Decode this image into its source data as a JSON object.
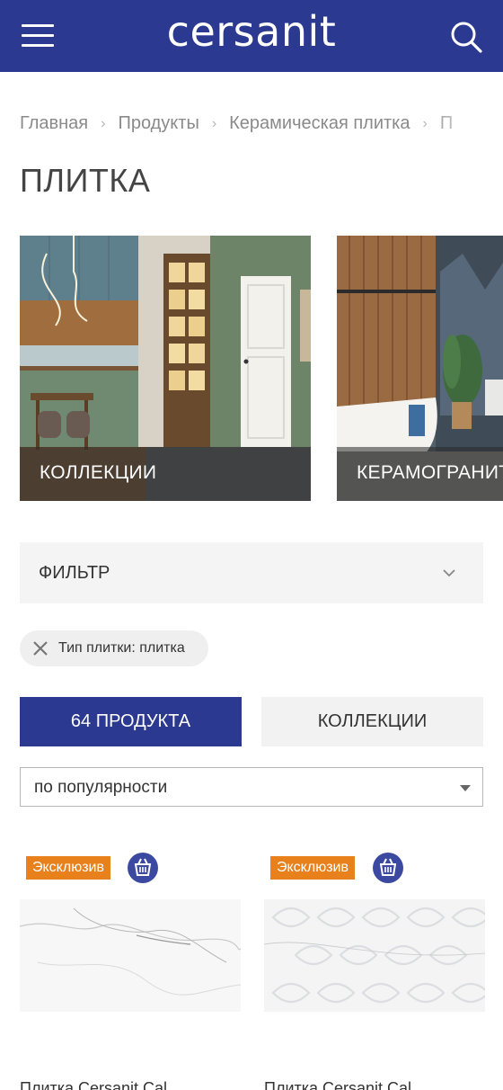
{
  "header": {
    "brand": "cersanit",
    "menu_icon": "hamburger-menu-icon",
    "search_icon": "search-icon",
    "bg_color": "#2b3990"
  },
  "breadcrumbs": [
    "Главная",
    "Продукты",
    "Керамическая плитка",
    "П"
  ],
  "page_title": "ПЛИТКА",
  "category_cards": [
    {
      "label": "КОЛЛЕКЦИИ"
    },
    {
      "label": "КЕРАМОГРАНИТ"
    }
  ],
  "filter": {
    "label": "ФИЛЬТР",
    "icon": "chevron-down-icon"
  },
  "active_filter_chip": {
    "label": "Тип плитки: плитка",
    "icon": "close-icon"
  },
  "tabs": {
    "products_label": "64 ПРОДУКТА",
    "collections_label": "КОЛЛЕКЦИИ",
    "active": "products"
  },
  "sort": {
    "selected": "по популярности",
    "icon": "caret-down-icon"
  },
  "products": [
    {
      "badge": "Эксклюзив",
      "badge_color": "#e8811b",
      "icon": "basket-icon",
      "name": "Плитка Cersanit Cal..."
    },
    {
      "badge": "Эксклюзив",
      "badge_color": "#e8811b",
      "icon": "basket-icon",
      "name": "Плитка Cersanit Cal..."
    }
  ]
}
